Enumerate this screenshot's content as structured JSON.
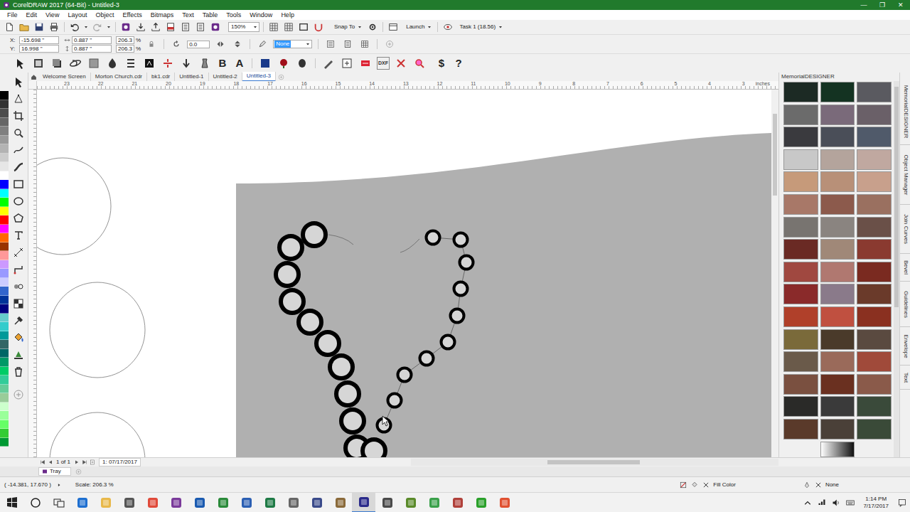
{
  "window": {
    "title": "CorelDRAW 2017 (64-Bit) - Untitled-3",
    "controls": [
      "—",
      "❐",
      "✕"
    ]
  },
  "menu": [
    "File",
    "Edit",
    "View",
    "Layout",
    "Object",
    "Effects",
    "Bitmaps",
    "Text",
    "Table",
    "Tools",
    "Window",
    "Help"
  ],
  "standard_toolbar": {
    "zoom": "150%",
    "snap": "Snap To",
    "launch": "Launch",
    "task": "Task 1 (18.56)"
  },
  "property_bar": {
    "x_label": "X:",
    "y_label": "Y:",
    "x": "-15.698 \"",
    "y": "16.998 \"",
    "width": "0.887 \"",
    "height": "0.887 \"",
    "scale_x": "206.3",
    "scale_y": "206.3",
    "scale_unit": "%",
    "angle": "0.0",
    "outline": "None"
  },
  "memorial_toolbar": {
    "dxf": "DXF",
    "bold": "B",
    "text": "A",
    "price": "$",
    "help": "?"
  },
  "doc_tabs": [
    {
      "label": "Welcome Screen",
      "selected": false
    },
    {
      "label": "Morton Church.cdr",
      "selected": false
    },
    {
      "label": "bk1.cdr",
      "selected": false
    },
    {
      "label": "Untitled-1",
      "selected": false
    },
    {
      "label": "Untitled-2",
      "selected": false
    },
    {
      "label": "Untitled-3",
      "selected": true
    }
  ],
  "ruler": {
    "ticks": [
      "23",
      "22",
      "21",
      "20",
      "19",
      "18",
      "17",
      "16",
      "15",
      "14",
      "13",
      "12",
      "11",
      "10",
      "9",
      "8",
      "7",
      "6",
      "5",
      "4",
      "3"
    ],
    "unit": "inches"
  },
  "palette": [
    {
      "color": "#000000"
    },
    {
      "color": "#333333"
    },
    {
      "color": "#4d4d4d"
    },
    {
      "color": "#666666"
    },
    {
      "color": "#808080"
    },
    {
      "color": "#999999"
    },
    {
      "color": "#b3b3b3"
    },
    {
      "color": "#cccccc"
    },
    {
      "color": "#e6e6e6"
    },
    {
      "color": "#ffffff"
    },
    {
      "color": "#0000ff"
    },
    {
      "color": "#00ffff"
    },
    {
      "color": "#00ff00"
    },
    {
      "color": "#ffff00"
    },
    {
      "color": "#ff0000"
    },
    {
      "color": "#ff00ff"
    },
    {
      "color": "#ff6600"
    },
    {
      "color": "#993300"
    },
    {
      "color": "#ff9999"
    },
    {
      "color": "#cc99ff"
    },
    {
      "color": "#9999ff"
    },
    {
      "color": "#ccccff"
    },
    {
      "color": "#3366cc"
    },
    {
      "color": "#003399"
    },
    {
      "color": "#000080"
    },
    {
      "color": "#66cccc"
    },
    {
      "color": "#33cccc"
    },
    {
      "color": "#009999"
    },
    {
      "color": "#336666"
    },
    {
      "color": "#006666"
    },
    {
      "color": "#009966"
    },
    {
      "color": "#00cc66"
    },
    {
      "color": "#33cc99"
    },
    {
      "color": "#66cc99"
    },
    {
      "color": "#99cc99"
    },
    {
      "color": "#ccffcc"
    },
    {
      "color": "#99ff99"
    },
    {
      "color": "#66ff66"
    },
    {
      "color": "#33cc33"
    },
    {
      "color": "#009933"
    }
  ],
  "docker": {
    "title": "MemorialDESIGNER",
    "swatches": [
      {
        "color": "#1c2a24"
      },
      {
        "color": "#143322"
      },
      {
        "color": "#5a5a60"
      },
      {
        "color": "#6b6b6b"
      },
      {
        "color": "#7a6a7a"
      },
      {
        "color": "#6a6068"
      },
      {
        "color": "#3a3a3e"
      },
      {
        "color": "#4a4e58"
      },
      {
        "color": "#505a6a"
      },
      {
        "color": "#c8c8c8"
      },
      {
        "color": "#b4a49c"
      },
      {
        "color": "#c0a8a0"
      },
      {
        "color": "#c69a7a"
      },
      {
        "color": "#b89078"
      },
      {
        "color": "#c8a08c"
      },
      {
        "color": "#a87868"
      },
      {
        "color": "#8c5a4c"
      },
      {
        "color": "#9a7060"
      },
      {
        "color": "#787470"
      },
      {
        "color": "#8a8480"
      },
      {
        "color": "#6a5048"
      },
      {
        "color": "#6a2a24"
      },
      {
        "color": "#a08878"
      },
      {
        "color": "#8a3a30"
      },
      {
        "color": "#a04840"
      },
      {
        "color": "#b07870"
      },
      {
        "color": "#7a2a20"
      },
      {
        "color": "#8a2a2a"
      },
      {
        "color": "#8a7a8a"
      },
      {
        "color": "#6a3a2a"
      },
      {
        "color": "#b0402a"
      },
      {
        "color": "#c05040"
      },
      {
        "color": "#8a3020"
      },
      {
        "color": "#7a6a3a"
      },
      {
        "color": "#4a3a2a"
      },
      {
        "color": "#5a4a40"
      },
      {
        "color": "#6a5a4a"
      },
      {
        "color": "#9a6a5a"
      },
      {
        "color": "#a04a3a"
      },
      {
        "color": "#7a5040"
      },
      {
        "color": "#6a3020"
      },
      {
        "color": "#8a5a4a"
      },
      {
        "color": "#2a2a28"
      },
      {
        "color": "#3a3a3a"
      },
      {
        "color": "#3a4a3a"
      },
      {
        "color": "#5a3a2a"
      },
      {
        "color": "#4a4038"
      },
      {
        "color": "#3a4a38"
      }
    ]
  },
  "side_tabs": [
    "MemorialDESIGNER",
    "Object Manager",
    "Join Curves",
    "Bevel",
    "Guidelines",
    "Envelope",
    "Text"
  ],
  "page_nav": {
    "pages": "1 of 1",
    "page_tab": "1: 07/17/2017"
  },
  "tray": {
    "label": "Tray"
  },
  "status_bar": {
    "coords": "( -14.381, 17.670 )",
    "scale": "Scale: 206.3 %",
    "fill": "Fill Color",
    "outline": "None"
  },
  "taskbar": {
    "time": "1:14 PM",
    "date": "7/17/2017"
  }
}
